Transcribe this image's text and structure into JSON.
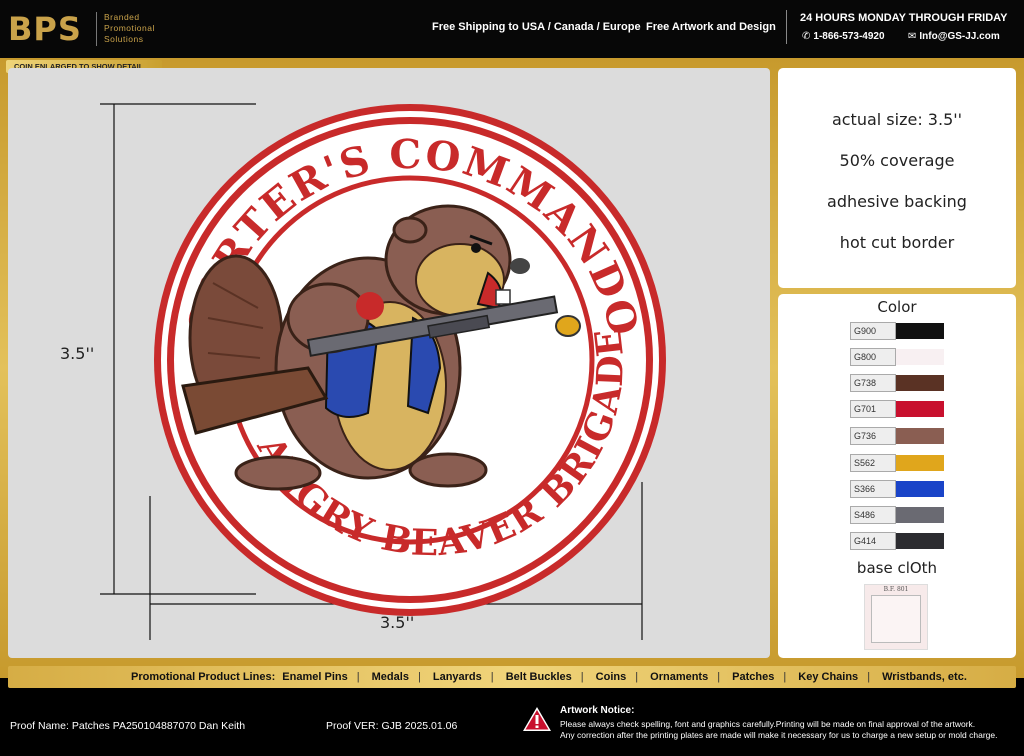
{
  "header": {
    "logo_mark": "BPS",
    "logo_lines": [
      "Branded",
      "Promotional",
      "Solutions"
    ],
    "shipping": "Free Shipping to USA / Canada / Europe",
    "artwork": "Free Artwork and Design",
    "hours": "24 HOURS MONDAY THROUGH FRIDAY",
    "phone": "1-866-573-4920",
    "email": "Info@GS-JJ.com"
  },
  "coin_note": "COIN ENLARGED TO SHOW DETAIL",
  "patch": {
    "top_text": "CARTER'S COMMANDO",
    "bottom_text": "ANGRY BEAVER BRIGADE",
    "height_label": "3.5''",
    "width_label": "3.5''"
  },
  "specs": [
    "actual size: 3.5''",
    "50% coverage",
    "adhesive backing",
    "hot cut border"
  ],
  "colors": {
    "title": "Color",
    "swatches": [
      {
        "code": "G900",
        "hex": "#111111"
      },
      {
        "code": "G800",
        "hex": "#f8f0f2"
      },
      {
        "code": "G738",
        "hex": "#5a3224"
      },
      {
        "code": "G701",
        "hex": "#c8102e"
      },
      {
        "code": "G736",
        "hex": "#8a5e52"
      },
      {
        "code": "S562",
        "hex": "#e0a61c"
      },
      {
        "code": "S366",
        "hex": "#1a44c8"
      },
      {
        "code": "S486",
        "hex": "#6a6a72"
      },
      {
        "code": "G414",
        "hex": "#2c2c30"
      }
    ]
  },
  "base_cloth": {
    "title": "base clOth",
    "code": "B.F. 801"
  },
  "product_lines": {
    "label": "Promotional Product Lines:",
    "items": [
      "Enamel Pins",
      "Medals",
      "Lanyards",
      "Belt Buckles",
      "Coins",
      "Ornaments",
      "Patches",
      "Key Chains",
      "Wristbands, etc."
    ]
  },
  "footer": {
    "proof_name": "Proof Name:  Patches PA250104887070 Dan Keith",
    "proof_ver": "Proof VER: GJB 2025.01.06",
    "notice_title": "Artwork Notice:",
    "notice_1": "Please always check spelling, font and graphics carefully.Printing will be made on final approval of the artwork.",
    "notice_2": "Any correction after the printing plates are made will make it necessary for us to charge a new setup or mold charge."
  }
}
